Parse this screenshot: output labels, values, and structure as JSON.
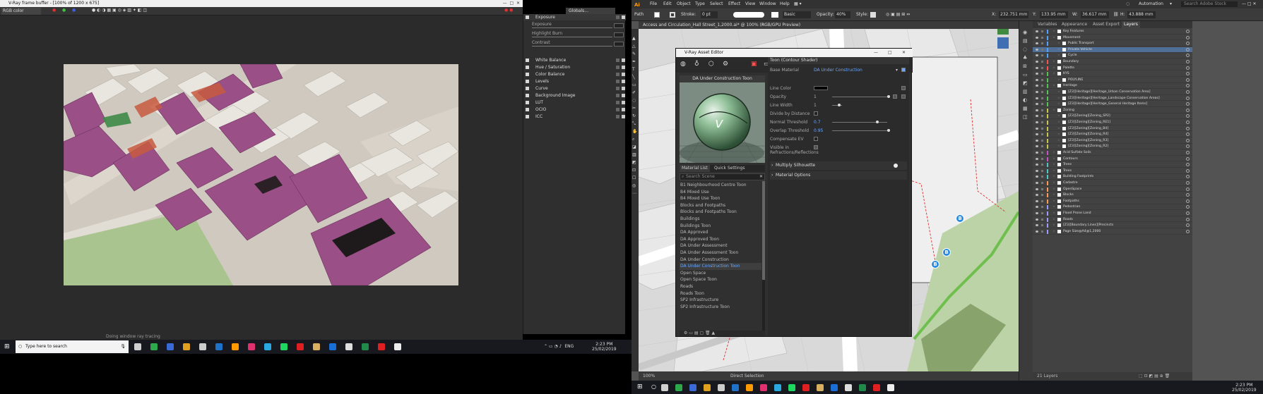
{
  "vfb": {
    "title": "V-Ray frame buffer - [100% of 1200 x 675]",
    "channel": "RGB color",
    "globals": "Globals...",
    "layers": [
      "Exposure",
      "White Balance",
      "Hue / Saturation",
      "Color Balance",
      "Levels",
      "Curve",
      "Background Image",
      "LUT",
      "OCIO",
      "ICC"
    ],
    "exposure_controls": [
      "Exposure",
      "Highlight Burn",
      "Contrast"
    ],
    "status": "Doing window ray tracing"
  },
  "taskbar_left": {
    "search_placeholder": "Type here to search",
    "lang": "ENG",
    "time": "2:23 PM",
    "date": "25/02/2019",
    "apps": [
      {
        "icon": "task-view-icon",
        "color": "#d0d0d0"
      },
      {
        "icon": "file-explorer-icon",
        "color": "#2da84a"
      },
      {
        "icon": "autocad-icon",
        "color": "#3a6ad6"
      },
      {
        "icon": "chrome-icon",
        "color": "#e0a020"
      },
      {
        "icon": "vray-icon",
        "color": "#cccccc"
      },
      {
        "icon": "photoshop-icon",
        "color": "#1e72c8"
      },
      {
        "icon": "illustrator-icon",
        "color": "#ff9a00"
      },
      {
        "icon": "indesign-icon",
        "color": "#e0306e"
      },
      {
        "icon": "lightroom-icon",
        "color": "#2aa8e0"
      },
      {
        "icon": "spotify-icon",
        "color": "#1ed760"
      },
      {
        "icon": "acrobat-icon",
        "color": "#e02020"
      },
      {
        "icon": "explorer-icon",
        "color": "#d8b060"
      },
      {
        "icon": "outlook-icon",
        "color": "#1a6fd6"
      },
      {
        "icon": "notepad-icon",
        "color": "#dddddd"
      },
      {
        "icon": "excel-icon",
        "color": "#1f8a4a"
      },
      {
        "icon": "acrobat-reader-icon",
        "color": "#e02020"
      },
      {
        "icon": "sketchup-icon",
        "color": "#eeeeee"
      }
    ]
  },
  "ai": {
    "logo": "Ai",
    "menus": [
      "File",
      "Edit",
      "Object",
      "Type",
      "Select",
      "Effect",
      "View",
      "Window",
      "Help"
    ],
    "workspace": "Automation",
    "search_placeholder": "Search Adobe Stock",
    "control": {
      "mode": "Path",
      "stroke_label": "Stroke:",
      "stroke_value": "0 pt",
      "brush": "Basic",
      "opacity_label": "Opacity:",
      "opacity": "40%",
      "style_label": "Style:",
      "x": "232.751 mm",
      "y": "133.95 mm",
      "w": "36.617 mm",
      "h": "43.888 mm"
    },
    "doc_tab": "Access and Circulation_Hall Street_1,2000.ai* @ 100% (RGB/GPU Preview)",
    "zoom": "100%",
    "tool": "Direct Selection",
    "layer_count": "21 Layers",
    "panel_tabs": [
      "Variables",
      "Appearance",
      "Asset Export",
      "Layers"
    ],
    "layers": [
      {
        "name": "Key Features",
        "color": "#4fa3ff",
        "indent": 1,
        "sel": false
      },
      {
        "name": "Movement",
        "color": "#4fa3ff",
        "indent": 1,
        "sel": false
      },
      {
        "name": "Public Transport",
        "color": "#4fa3ff",
        "indent": 2,
        "sel": false
      },
      {
        "name": "Private Vehicle",
        "color": "#4fa3ff",
        "indent": 2,
        "sel": true
      },
      {
        "name": "Cycle",
        "color": "#4fa3ff",
        "indent": 2,
        "sel": false
      },
      {
        "name": "Boundary",
        "color": "#ff5050",
        "indent": 1,
        "sel": false
      },
      {
        "name": "Palette",
        "color": "#ff5050",
        "indent": 1,
        "sel": false
      },
      {
        "name": "KYS",
        "color": "#50c850",
        "indent": 1,
        "sel": false
      },
      {
        "name": "POLYLINE",
        "color": "#50c850",
        "indent": 2,
        "sel": false
      },
      {
        "name": "Heritage",
        "color": "#50c850",
        "indent": 1,
        "sel": false
      },
      {
        "name": "[Z3][Heritage][Heritage_Urban Conservation Area]",
        "color": "#50c850",
        "indent": 2,
        "sel": false
      },
      {
        "name": "[Z3][Heritage][Heritage_Landscape Conservation Areas]",
        "color": "#50c850",
        "indent": 2,
        "sel": false
      },
      {
        "name": "[Z3][Heritage][Heritage_General Heritage Items]",
        "color": "#50c850",
        "indent": 2,
        "sel": false
      },
      {
        "name": "Zoning",
        "color": "#c8c850",
        "indent": 1,
        "sel": false
      },
      {
        "name": "[Z3][Zoning][Zoning_SP2]",
        "color": "#c8c850",
        "indent": 2,
        "sel": false
      },
      {
        "name": "[Z3][Zoning][Zoning_RE1]",
        "color": "#c8c850",
        "indent": 2,
        "sel": false
      },
      {
        "name": "[Z3][Zoning][Zoning_B4]",
        "color": "#c8c850",
        "indent": 2,
        "sel": false
      },
      {
        "name": "[Z3][Zoning][Zoning_R4]",
        "color": "#c8c850",
        "indent": 2,
        "sel": false
      },
      {
        "name": "[Z3][Zoning][Zoning_R3]",
        "color": "#c8c850",
        "indent": 2,
        "sel": false
      },
      {
        "name": "[Z3][Zoning][Zoning_R2]",
        "color": "#c8c850",
        "indent": 2,
        "sel": false
      },
      {
        "name": "Acid Sulfate Soils",
        "color": "#c850c8",
        "indent": 1,
        "sel": false
      },
      {
        "name": "Contours",
        "color": "#c850c8",
        "indent": 1,
        "sel": false
      },
      {
        "name": "Trees",
        "color": "#50c8c8",
        "indent": 1,
        "sel": false
      },
      {
        "name": "Trees",
        "color": "#50c8c8",
        "indent": 1,
        "sel": false
      },
      {
        "name": "Building Footprints",
        "color": "#50c8c8",
        "indent": 1,
        "sel": false
      },
      {
        "name": "Cadastre",
        "color": "#ff9a50",
        "indent": 1,
        "sel": false
      },
      {
        "name": "OpenSpace",
        "color": "#ff9a50",
        "indent": 1,
        "sel": false
      },
      {
        "name": "Blocks",
        "color": "#ff9a50",
        "indent": 1,
        "sel": false
      },
      {
        "name": "Footpaths",
        "color": "#ff9a50",
        "indent": 1,
        "sel": false
      },
      {
        "name": "Pedestrian",
        "color": "#9a9aff",
        "indent": 1,
        "sel": false
      },
      {
        "name": "Flood Prone Land",
        "color": "#9a9aff",
        "indent": 1,
        "sel": false
      },
      {
        "name": "Roads",
        "color": "#9a9aff",
        "indent": 1,
        "sel": false
      },
      {
        "name": "[Z3][Boundary Lines][Precincts",
        "color": "#9a9aff",
        "indent": 1,
        "sel": false
      },
      {
        "name": "Page Size@A4@1,2000",
        "color": "#9a9aff",
        "indent": 1,
        "sel": false
      }
    ],
    "bus_stop_label": "B"
  },
  "asset_editor": {
    "title": "V-Ray Asset Editor",
    "preview_title": "DA Under Construction Toon",
    "tabs": [
      "Material List",
      "Quick Settings"
    ],
    "search_placeholder": "Search Scene",
    "materials": [
      "B1 Neighbourhood Centre Toon",
      "B4 Mixed Use",
      "B4 Mixed Use Toon",
      "Blocks and Footpaths",
      "Blocks and Footpaths Toon",
      "Buildings",
      "Buildings Toon",
      "DA Approved",
      "DA Approved Toon",
      "DA Under Assessment",
      "DA Under Assessment Toon",
      "DA Under Construction",
      "DA Under Construction Toon",
      "Open Space",
      "Open Space Toon",
      "Roads",
      "Roads Toon",
      "SP2 Infrastructure",
      "SP2 Infrastructure Toon"
    ],
    "selected_material": "DA Under Construction Toon",
    "header": "Toon (Contour Shader)",
    "props": {
      "base_material_label": "Base Material",
      "base_material": "DA Under Construction",
      "line_color": "Line Color",
      "opacity": "Opacity",
      "opacity_val": "1",
      "line_width": "Line Width",
      "line_width_val": "1",
      "divide": "Divide by Distance",
      "normal_threshold": "Normal Threshold",
      "normal_threshold_val": "0.7",
      "overlap_threshold": "Overlap Threshold",
      "overlap_threshold_val": "0.95",
      "compensate": "Compensate EV",
      "visible": "Visible in Refractions/Reflections"
    },
    "sections": [
      "Multiply Silhouette",
      "Material Options"
    ]
  },
  "taskbar_right": {
    "time": "2:23 PM",
    "date": "25/02/2019"
  },
  "colors": {
    "buildings_pink": "#9a4f86",
    "buildings_white": "#e9e6df",
    "road": "#cfc9bf",
    "grass": "#a9c48f",
    "accent_blue": "#6aa8ff"
  }
}
